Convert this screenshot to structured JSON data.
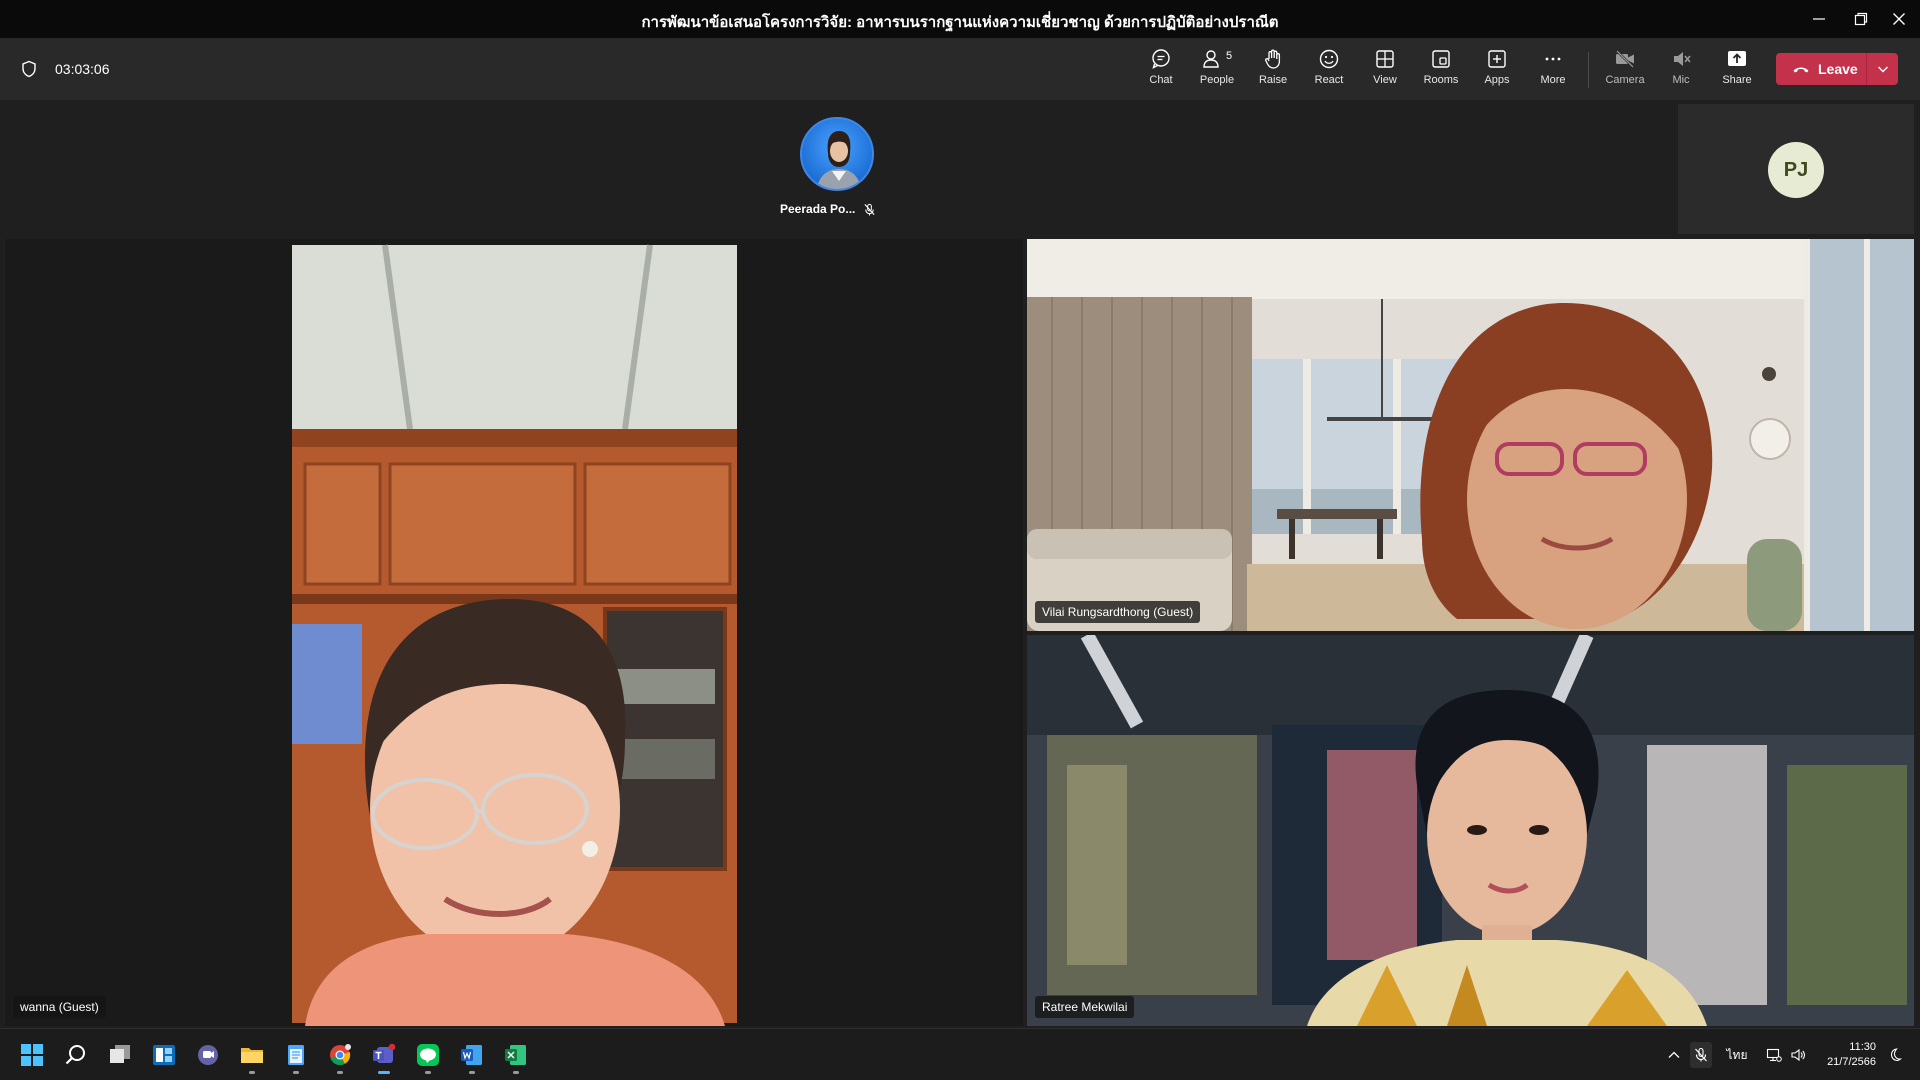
{
  "window": {
    "title": "การพัฒนาข้อเสนอโครงการวิจัย: อาหารบนรากฐานแห่งความเชี่ยวชาญ ด้วยการปฏิบัติอย่างปราณีต"
  },
  "toolbar": {
    "timer": "03:03:06",
    "buttons": {
      "chat": "Chat",
      "people": "People",
      "people_count": "5",
      "raise": "Raise",
      "react": "React",
      "view": "View",
      "rooms": "Rooms",
      "apps": "Apps",
      "more": "More",
      "camera": "Camera",
      "mic": "Mic",
      "share": "Share"
    },
    "leave_label": "Leave"
  },
  "participants": {
    "top_avatar_name": "Peerada Po...",
    "pj_initials": "PJ",
    "tiles": [
      {
        "name": "wanna (Guest)"
      },
      {
        "name": "Vilai Rungsardthong (Guest)"
      },
      {
        "name": "Ratree Mekwilai"
      }
    ]
  },
  "taskbar": {
    "language": "ไทย",
    "time": "11:30",
    "date": "21/7/2566"
  },
  "colors": {
    "accent_outline": "#7f85f5",
    "leave_red": "#c4314b",
    "avatar_blue": "#1d6fd6",
    "pj_bg": "#e7ebd3"
  }
}
